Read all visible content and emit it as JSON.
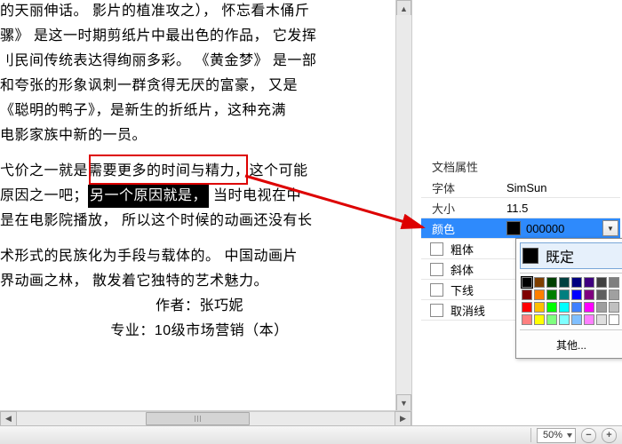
{
  "doc": {
    "p1": "的天丽伸话。  影片的植准攻之），  怀忘看木俑斤",
    "p2": "骡》 是这一时期剪纸片中最出色的作品，  它发挥",
    "p3": "刂民间传统表达得绚丽多彩。   《黄金梦》 是一部",
    "p4": "和夸张的形象讽刺一群贪得无厌的富豪，  又是",
    "p5": "《聪明的鸭子》，是新生的折纸片，这种充满",
    "p6": "电影家族中新的一员。",
    "p7_a": "弋价之一就是需要更多的时间与精力，这个可能",
    "p7_b": "原因之一吧；",
    "p7_hl": "另一个原因就是，",
    "p7_c": "当时电视在中",
    "p8": "昰在电影院播放，  所以这个时候的动画还没有长",
    "p9": "术形式的民族化为手段与载体的。  中国动画片",
    "p10": "界动画之林，  散发着它独特的艺术魅力。",
    "author_label": "作者：",
    "author_name": "张巧妮",
    "major_label": "专业：",
    "major_value": "10级市场营销（本）"
  },
  "panel": {
    "title": "文档属性",
    "rows": {
      "font_label": "字体",
      "font_value": "SimSun",
      "size_label": "大小",
      "size_value": "11.5",
      "color_label": "颜色",
      "color_value": "000000",
      "bold_label": "粗体",
      "italic_label": "斜体",
      "underline_label": "下线",
      "strike_label": "取消线"
    },
    "color_popup": {
      "default_label": "既定",
      "other_label": "其他...",
      "colors": [
        "#000000",
        "#7f3f00",
        "#003f00",
        "#003f3f",
        "#00007f",
        "#3f007f",
        "#3f3f3f",
        "#7f7f7f",
        "#7f0000",
        "#ff7f00",
        "#007f00",
        "#007f7f",
        "#0000ff",
        "#7f007f",
        "#5f5f5f",
        "#a0a0a0",
        "#ff0000",
        "#ffbf00",
        "#00ff00",
        "#00ffff",
        "#3f7fff",
        "#ff00ff",
        "#9f9f9f",
        "#c0c0c0",
        "#ff7f7f",
        "#ffff00",
        "#7fff7f",
        "#7fffff",
        "#7fbfff",
        "#ff7fff",
        "#dfdfdf",
        "#ffffff"
      ]
    }
  },
  "statusbar": {
    "zoom": "50%"
  }
}
